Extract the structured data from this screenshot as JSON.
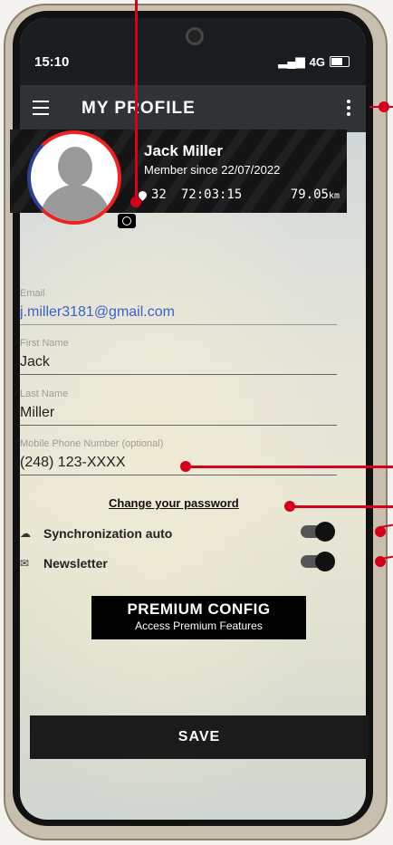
{
  "status_bar": {
    "time": "15:10",
    "network": "4G"
  },
  "app_bar": {
    "title": "MY PROFILE"
  },
  "banner": {
    "name": "Jack Miller",
    "member_since": "Member since 22/07/2022",
    "rides": "32",
    "duration": "72:03:15",
    "distance": "79.05",
    "distance_unit": "km"
  },
  "form": {
    "email": {
      "label": "Email",
      "value": "j.miller3181@gmail.com"
    },
    "first_name": {
      "label": "First Name",
      "value": "Jack"
    },
    "last_name": {
      "label": "Last Name",
      "value": "Miller"
    },
    "phone": {
      "label": "Mobile Phone Number (optional)",
      "value": "(248) 123-XXXX"
    }
  },
  "change_password": "Change your password",
  "toggles": {
    "sync": {
      "label": "Synchronization auto",
      "icon": "cloud-icon",
      "on": true
    },
    "newsletter": {
      "label": "Newsletter",
      "icon": "mail-icon",
      "on": true
    }
  },
  "premium": {
    "title": "PREMIUM CONFIG",
    "subtitle": "Access Premium Features"
  },
  "save_label": "SAVE",
  "colors": {
    "callout": "#d6001c",
    "appbar": "#2f3336"
  }
}
